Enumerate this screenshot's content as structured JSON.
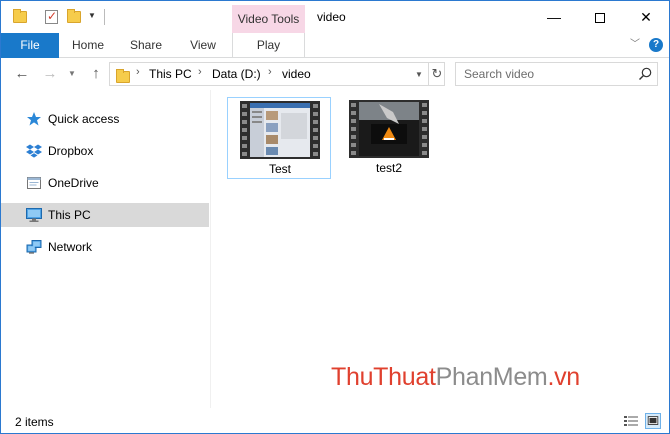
{
  "window": {
    "title": "video",
    "contextual_group": "Video Tools",
    "controls": {
      "minimize": "—",
      "close": "✕"
    }
  },
  "ribbon": {
    "tabs": [
      "File",
      "Home",
      "Share",
      "View",
      "Play"
    ],
    "help": "?"
  },
  "navigation": {
    "breadcrumb": [
      "This PC",
      "Data (D:)",
      "video"
    ],
    "search_placeholder": "Search video"
  },
  "sidebar": {
    "items": [
      {
        "label": "Quick access",
        "icon": "star-icon",
        "selected": false
      },
      {
        "label": "Dropbox",
        "icon": "dropbox-icon",
        "selected": false
      },
      {
        "label": "OneDrive",
        "icon": "onedrive-icon",
        "selected": false
      },
      {
        "label": "This PC",
        "icon": "monitor-icon",
        "selected": true
      },
      {
        "label": "Network",
        "icon": "network-icon",
        "selected": false
      }
    ]
  },
  "files": [
    {
      "name": "Test",
      "type": "video",
      "selected": true
    },
    {
      "name": "test2",
      "type": "video",
      "selected": false
    }
  ],
  "watermark": {
    "part1": "ThuThuat",
    "part2": "PhanMem",
    "part3": ".vn"
  },
  "status": {
    "item_count": "2 items"
  },
  "colors": {
    "accent": "#1979ca",
    "contextual_tab": "#f7d7e6",
    "selected_nav": "#d9d9d9",
    "selected_tile_border": "#99d1ff",
    "watermark_red": "#e0402e",
    "watermark_gray": "#8c8c8c"
  }
}
